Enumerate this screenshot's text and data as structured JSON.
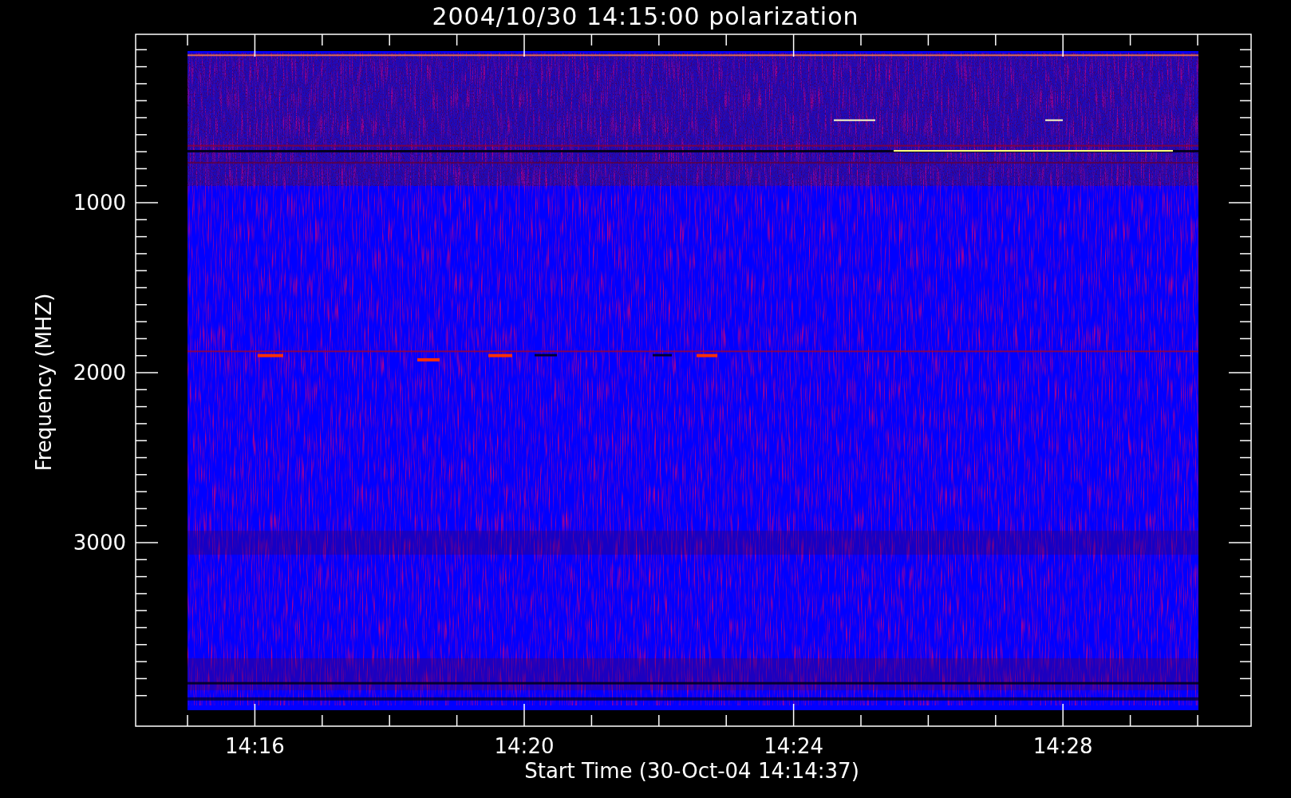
{
  "plot": {
    "title": "2004/10/30 14:15:00 polarization",
    "y_axis": {
      "label": "Frequency (MHZ)",
      "tick_labels": [
        "1000",
        "2000",
        "3000"
      ]
    },
    "x_axis": {
      "label": "Start Time (30-Oct-04 14:14:37)",
      "tick_labels": [
        "14:16",
        "14:20",
        "14:24",
        "14:28"
      ]
    }
  }
}
